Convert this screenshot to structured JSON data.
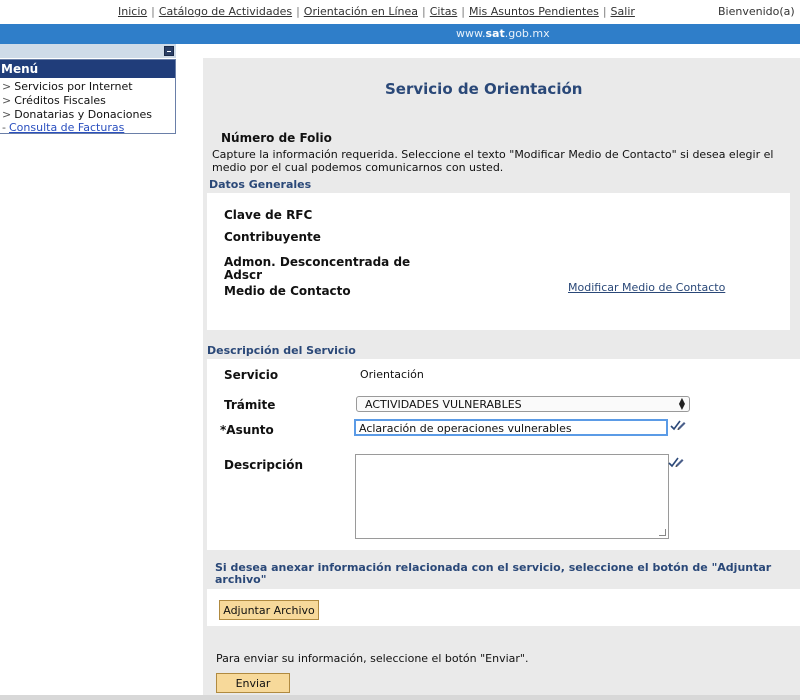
{
  "topnav": {
    "links": [
      "Inicio",
      "Catálogo de Actividades",
      "Orientación en Línea",
      "Citas",
      "Mis Asuntos Pendientes",
      "Salir"
    ],
    "welcome": "Bienvenido(a)"
  },
  "header": {
    "site_prefix": "www.",
    "site_brand": "sat",
    "site_suffix": ".gob.mx"
  },
  "menu": {
    "title": "Menú",
    "items": [
      {
        "label": "Servicios por Internet"
      },
      {
        "label": "Créditos Fiscales"
      },
      {
        "label": "Donatarias y Donaciones"
      },
      {
        "label": "Consulta de Facturas"
      }
    ]
  },
  "main": {
    "title": "Servicio de Orientación",
    "folio_label": "Número de Folio",
    "instructions": "Capture la información requerida. Seleccione el texto \"Modificar Medio de Contacto\" si desea elegir el medio por el cual podemos comunicarnos con usted.",
    "datos_generales": {
      "section_title": "Datos Generales",
      "rfc_label": "Clave de RFC",
      "contribuyente_label": "Contribuyente",
      "admon_label_line1": "Admon. Desconcentrada de",
      "admon_label_line2": "Adscr",
      "medio_label": "Medio de Contacto",
      "modificar_link": "Modificar Medio de Contacto"
    },
    "descripcion_servicio": {
      "section_title": "Descripción del Servicio",
      "servicio_label": "Servicio",
      "servicio_value": "Orientación",
      "tramite_label": "Trámite",
      "tramite_selected": "ACTIVIDADES VULNERABLES",
      "asunto_label": "*Asunto",
      "asunto_value": "Aclaración de operaciones vulnerables",
      "descripcion_label": "Descripción",
      "descripcion_value": ""
    },
    "attach": {
      "text": "Si desea anexar información relacionada con el servicio, seleccione el botón de \"Adjuntar archivo\"",
      "button": "Adjuntar Archivo"
    },
    "send": {
      "text": "Para enviar su información, seleccione el botón \"Enviar\".",
      "button": "Enviar"
    }
  }
}
